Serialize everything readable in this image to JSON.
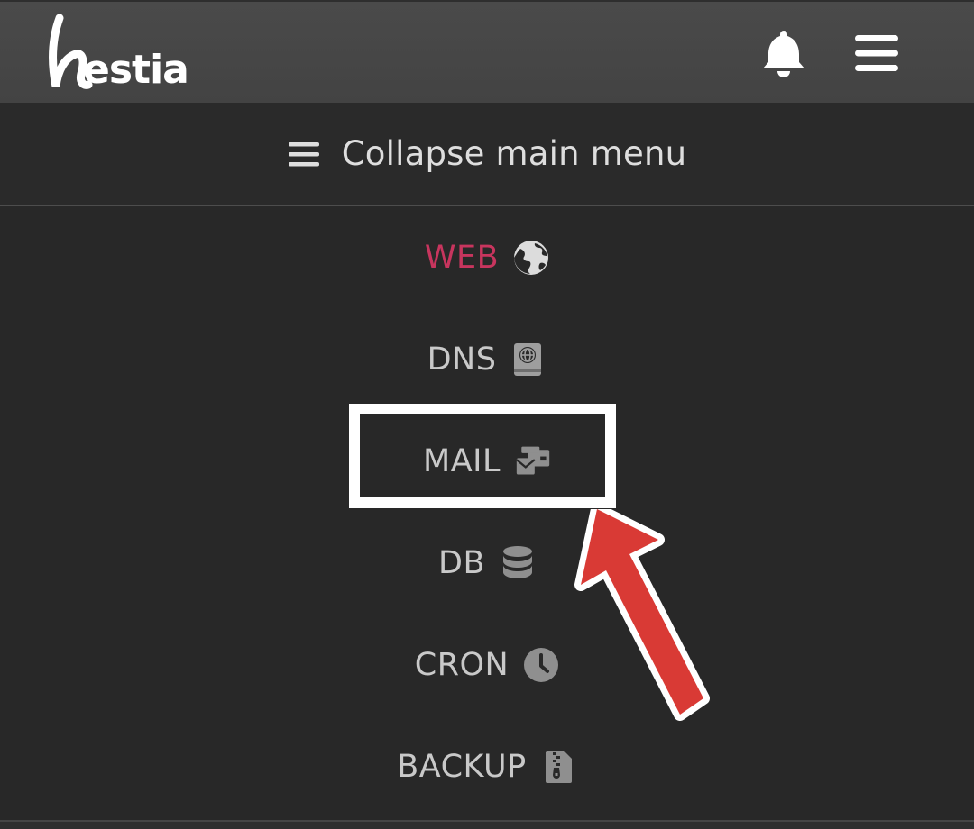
{
  "header": {
    "logo_text": "hestia",
    "notifications_icon": "bell-icon",
    "menu_icon": "hamburger-icon"
  },
  "collapse": {
    "label": "Collapse main menu",
    "icon": "hamburger-icon"
  },
  "menu": {
    "items": [
      {
        "label": "WEB",
        "icon": "globe-icon",
        "active": true
      },
      {
        "label": "DNS",
        "icon": "address-book-globe-icon",
        "active": false
      },
      {
        "label": "MAIL",
        "icon": "mail-bulk-icon",
        "active": false
      },
      {
        "label": "DB",
        "icon": "database-icon",
        "active": false
      },
      {
        "label": "CRON",
        "icon": "clock-icon",
        "active": false
      },
      {
        "label": "BACKUP",
        "icon": "file-archive-icon",
        "active": false
      }
    ]
  },
  "annotation": {
    "highlighted_item": "MAIL",
    "arrow_color": "#d93a35",
    "box_color": "#ffffff"
  },
  "colors": {
    "active": "#c8355e",
    "text": "#c9c9c9",
    "icon": "#bdbdbd",
    "header_bg": "#474747",
    "menu_bg": "#282828"
  }
}
